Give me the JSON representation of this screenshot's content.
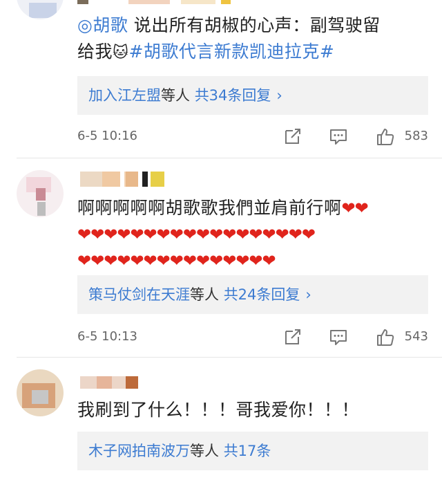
{
  "comments": [
    {
      "topic_link": "◎胡歌",
      "text_part1": " 说出所有胡椒的心声：副驾驶留",
      "text_part2": "给我",
      "emoji": "🐱",
      "hashtag": "#胡歌代言新款凯迪拉克#",
      "reply_user": "加入江左盟",
      "reply_mid": "等人",
      "reply_count": "共34条回复",
      "reply_chev": "›",
      "time": "6-5 10:16",
      "likes": "583"
    },
    {
      "text_line1": "啊啊啊啊啊胡歌歌我們並肩前行啊",
      "hearts_line1": "❤❤",
      "hearts_line2": "❤❤❤❤❤❤❤❤❤❤❤❤❤❤❤❤❤❤",
      "hearts_line3": "❤❤❤❤❤❤❤❤❤❤❤❤❤❤❤",
      "reply_user": "策马仗剑在天涯",
      "reply_mid": "等人",
      "reply_count": "共24条回复",
      "reply_chev": "›",
      "time": "6-5 10:13",
      "likes": "543"
    },
    {
      "text": "我刷到了什么！！！哥我爱你！！！",
      "reply_user": "木子网拍南波万",
      "reply_mid": "等人",
      "reply_count": "共17条"
    }
  ],
  "icons": [
    "share-icon",
    "comment-icon",
    "like-icon"
  ],
  "colors": {
    "link": "#3c7bd1",
    "heart": "#e0241c",
    "reply_bg": "#f2f2f2"
  }
}
